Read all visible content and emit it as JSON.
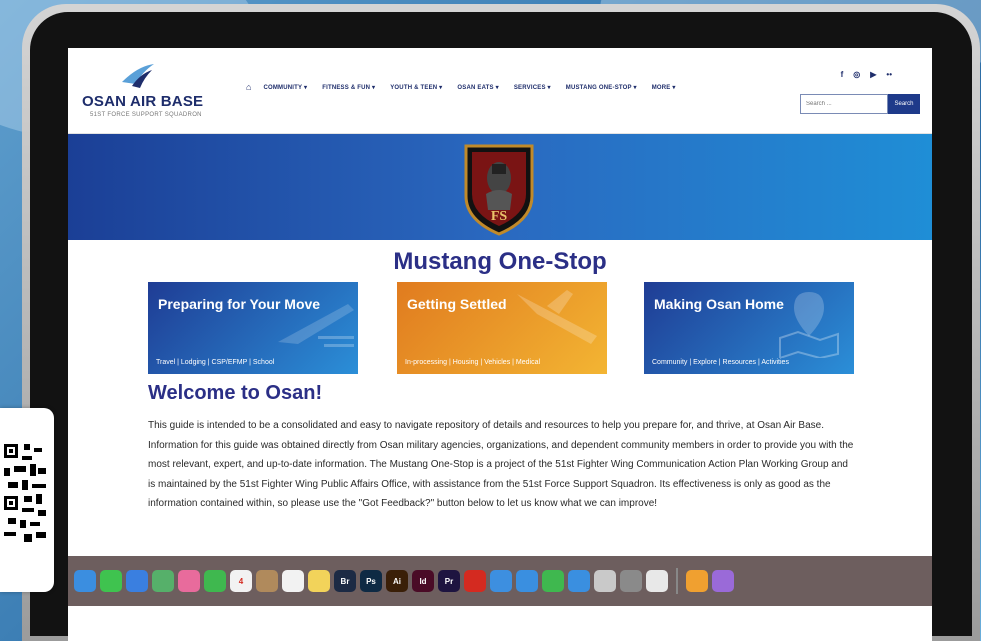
{
  "site": {
    "logo_title": "OSAN AIR BASE",
    "logo_subtitle": "51ST FORCE SUPPORT SQUADRON"
  },
  "nav": {
    "home_icon": "home-icon",
    "items": [
      "COMMUNITY ▾",
      "FITNESS & FUN ▾",
      "YOUTH & TEEN ▾",
      "OSAN EATS ▾",
      "SERVICES ▾",
      "MUSTANG ONE-STOP ▾",
      "MORE ▾"
    ]
  },
  "social": [
    "f",
    "◎",
    "▶",
    "••"
  ],
  "search": {
    "placeholder": "Search ...",
    "button_label": "Search"
  },
  "page_title": "Mustang One-Stop",
  "cards": [
    {
      "title": "Preparing for Your Move",
      "links": "Travel | Lodging | CSP/EFMP | School",
      "color_start": "#1f3c94",
      "color_end": "#2b8fd8"
    },
    {
      "title": "Getting Settled",
      "links": "In-processing | Housing | Vehicles | Medical",
      "color_start": "#e07b1f",
      "color_end": "#f3b533"
    },
    {
      "title": "Making Osan Home",
      "links": "Community | Explore | Resources | Activities",
      "color_start": "#1f3c94",
      "color_end": "#2b8fd8"
    }
  ],
  "welcome_heading": "Welcome to Osan!",
  "welcome_body": "This guide is intended to be a consolidated and easy to navigate repository of details and resources to help you prepare for, and thrive, at Osan Air Base. Information for this guide was obtained directly from Osan military agencies, organizations, and dependent community members in order to provide you with the most relevant, expert, and up-to-date information. The Mustang One-Stop is a project of the 51st Fighter Wing Communication Action Plan Working Group and is maintained by the 51st Fighter Wing Public Affairs Office, with assistance from the 51st Force Support Squadron. Its effectiveness is only as good as the information contained within, so please use the \"Got Feedback?\" button below to let us know what we can improve!",
  "dock": {
    "apps": [
      {
        "label": "",
        "icon": "finder-icon",
        "color": "#3b8ee0"
      },
      {
        "label": "",
        "icon": "messages-icon",
        "color": "#3fc34f"
      },
      {
        "label": "",
        "icon": "mail-icon",
        "color": "#3a7fe0"
      },
      {
        "label": "",
        "icon": "maps-icon",
        "color": "#56b06a"
      },
      {
        "label": "",
        "icon": "photos-icon",
        "color": "#e86b9c"
      },
      {
        "label": "",
        "icon": "facetime-icon",
        "color": "#3fb84f"
      },
      {
        "label": "4",
        "icon": "calendar-icon",
        "color": "#f2f2f2"
      },
      {
        "label": "",
        "icon": "contacts-icon",
        "color": "#b08a5c"
      },
      {
        "label": "",
        "icon": "reminders-icon",
        "color": "#f2f2f2"
      },
      {
        "label": "",
        "icon": "notes-icon",
        "color": "#f2d35a"
      },
      {
        "label": "Br",
        "icon": "bridge-icon",
        "color": "#1c2a44"
      },
      {
        "label": "Ps",
        "icon": "photoshop-icon",
        "color": "#0e2a44"
      },
      {
        "label": "Ai",
        "icon": "illustrator-icon",
        "color": "#3a1f08"
      },
      {
        "label": "Id",
        "icon": "indesign-icon",
        "color": "#4a0b26"
      },
      {
        "label": "Pr",
        "icon": "premiere-icon",
        "color": "#1e1440"
      },
      {
        "label": "",
        "icon": "acrobat-icon",
        "color": "#d42a20"
      },
      {
        "label": "",
        "icon": "safari-icon",
        "color": "#3d8fe0"
      },
      {
        "label": "",
        "icon": "keynote-icon",
        "color": "#3a8fe0"
      },
      {
        "label": "",
        "icon": "numbers-icon",
        "color": "#3fb84f"
      },
      {
        "label": "",
        "icon": "app-store-icon",
        "color": "#3a8fe0"
      },
      {
        "label": "",
        "icon": "screenshot-icon",
        "color": "#c9c9c9"
      },
      {
        "label": "",
        "icon": "settings-icon",
        "color": "#8a8a8a"
      },
      {
        "label": "",
        "icon": "chrome-icon",
        "color": "#e8e8e8"
      }
    ],
    "extras": [
      {
        "icon": "pages-icon",
        "color": "#f0a030"
      },
      {
        "icon": "preview-icon",
        "color": "#9a6ad8"
      }
    ]
  }
}
